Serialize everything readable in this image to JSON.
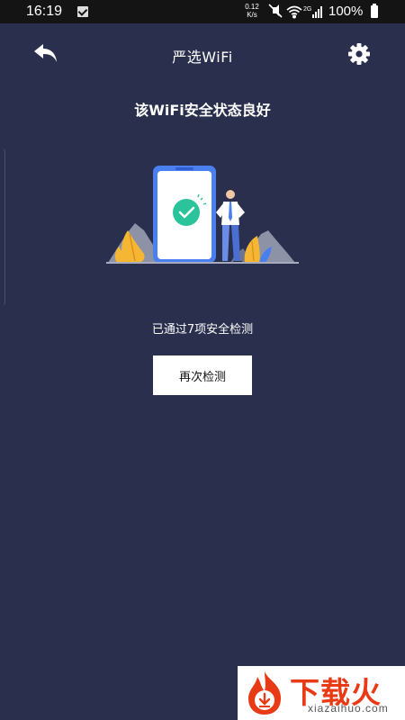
{
  "status_bar": {
    "time": "16:19",
    "net_speed_value": "0.12",
    "net_speed_unit": "K/s",
    "network_type": "2G",
    "battery": "100%"
  },
  "header": {
    "title": "严选WiFi",
    "back_icon": "back-arrow-icon",
    "settings_icon": "gear-icon"
  },
  "main": {
    "status_title": "该WiFi安全状态良好",
    "checks_passed": "已通过7项安全检测",
    "recheck_label": "再次检测"
  },
  "watermark": {
    "brand": "下载火",
    "site": "xiazaihuo.com"
  },
  "colors": {
    "background": "#292f4d",
    "phone_blue": "#4a7ff0",
    "check_green": "#2bc49a",
    "plant_yellow": "#f5b733",
    "watermark_red": "#e83a14"
  }
}
